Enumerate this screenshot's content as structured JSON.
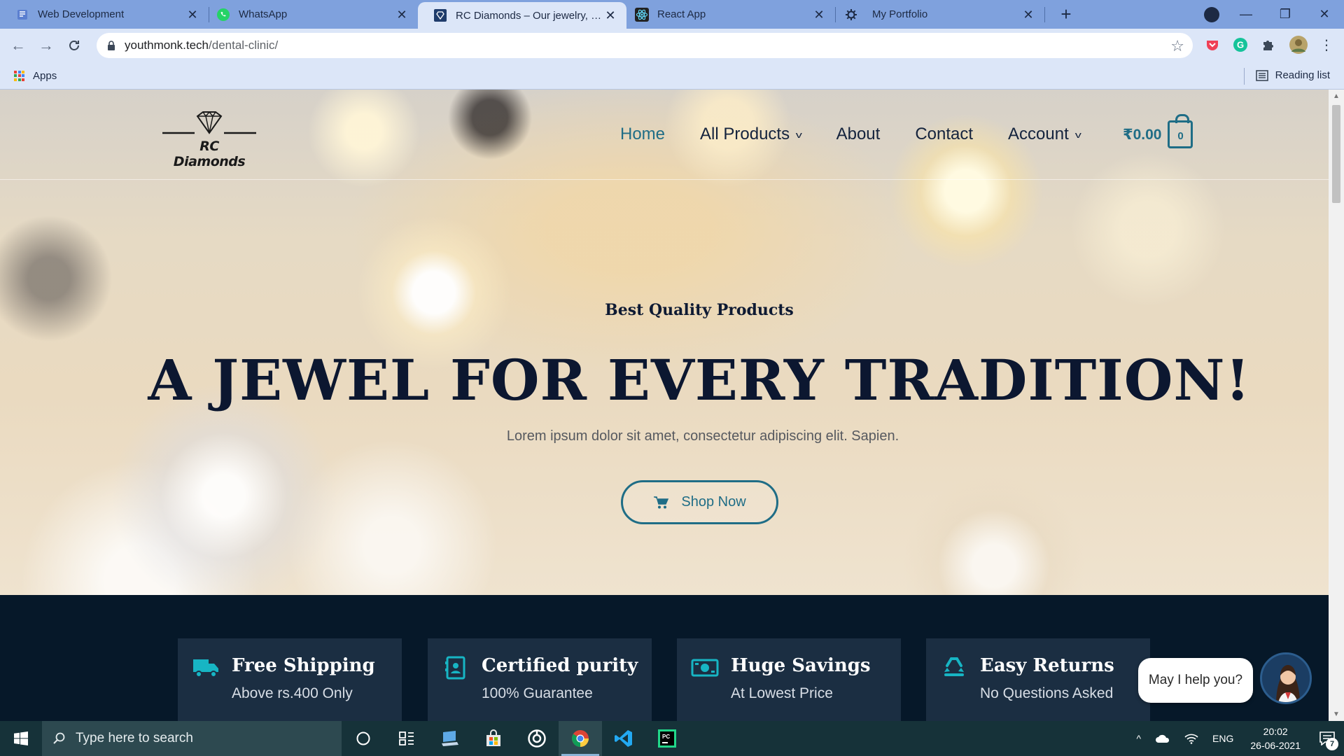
{
  "browser": {
    "tabs": [
      {
        "title": "Web Development",
        "icon": "page-icon"
      },
      {
        "title": "WhatsApp",
        "icon": "whatsapp-icon"
      },
      {
        "title": "RC Diamonds – Our jewelry, your story",
        "icon": "diamond-favicon"
      },
      {
        "title": "React App",
        "icon": "react-icon"
      },
      {
        "title": "My Portfolio",
        "icon": "portfolio-icon"
      }
    ],
    "active_tab_index": 2,
    "url_host": "youthmonk.tech",
    "url_path": "/dental-clinic/",
    "bookmarks_apps": "Apps",
    "reading_list": "Reading list"
  },
  "site": {
    "logo_text": "RC Diamonds",
    "nav": {
      "home": "Home",
      "all_products": "All Products",
      "about": "About",
      "contact": "Contact",
      "account": "Account"
    },
    "cart": {
      "amount": "₹0.00",
      "count": "0"
    },
    "hero": {
      "subtitle": "Best Quality Products",
      "title": "A JEWEL FOR EVERY TRADITION!",
      "text": "Lorem ipsum dolor sit amet, consectetur adipiscing  elit. Sapien.",
      "button": "Shop Now"
    },
    "features": [
      {
        "title": "Free Shipping",
        "subtitle": "Above rs.400 Only",
        "icon": "truck-icon"
      },
      {
        "title": "Certified purity",
        "subtitle": "100% Guarantee",
        "icon": "certificate-icon"
      },
      {
        "title": "Huge Savings",
        "subtitle": "At Lowest Price",
        "icon": "money-icon"
      },
      {
        "title": "Easy Returns",
        "subtitle": "No Questions Asked",
        "icon": "recycle-icon"
      }
    ],
    "chat": {
      "prompt": "May I help you?"
    }
  },
  "taskbar": {
    "search_placeholder": "Type here to search",
    "language": "ENG",
    "time": "20:02",
    "date": "26-06-2021",
    "notification_count": "7"
  },
  "colors": {
    "accent": "#1f6d86",
    "navy": "#0c1730",
    "feature_bg": "#1b2e42",
    "dark_band": "#061829",
    "taskbar": "#163239",
    "chrome_tabbar": "#7fa1dd"
  }
}
